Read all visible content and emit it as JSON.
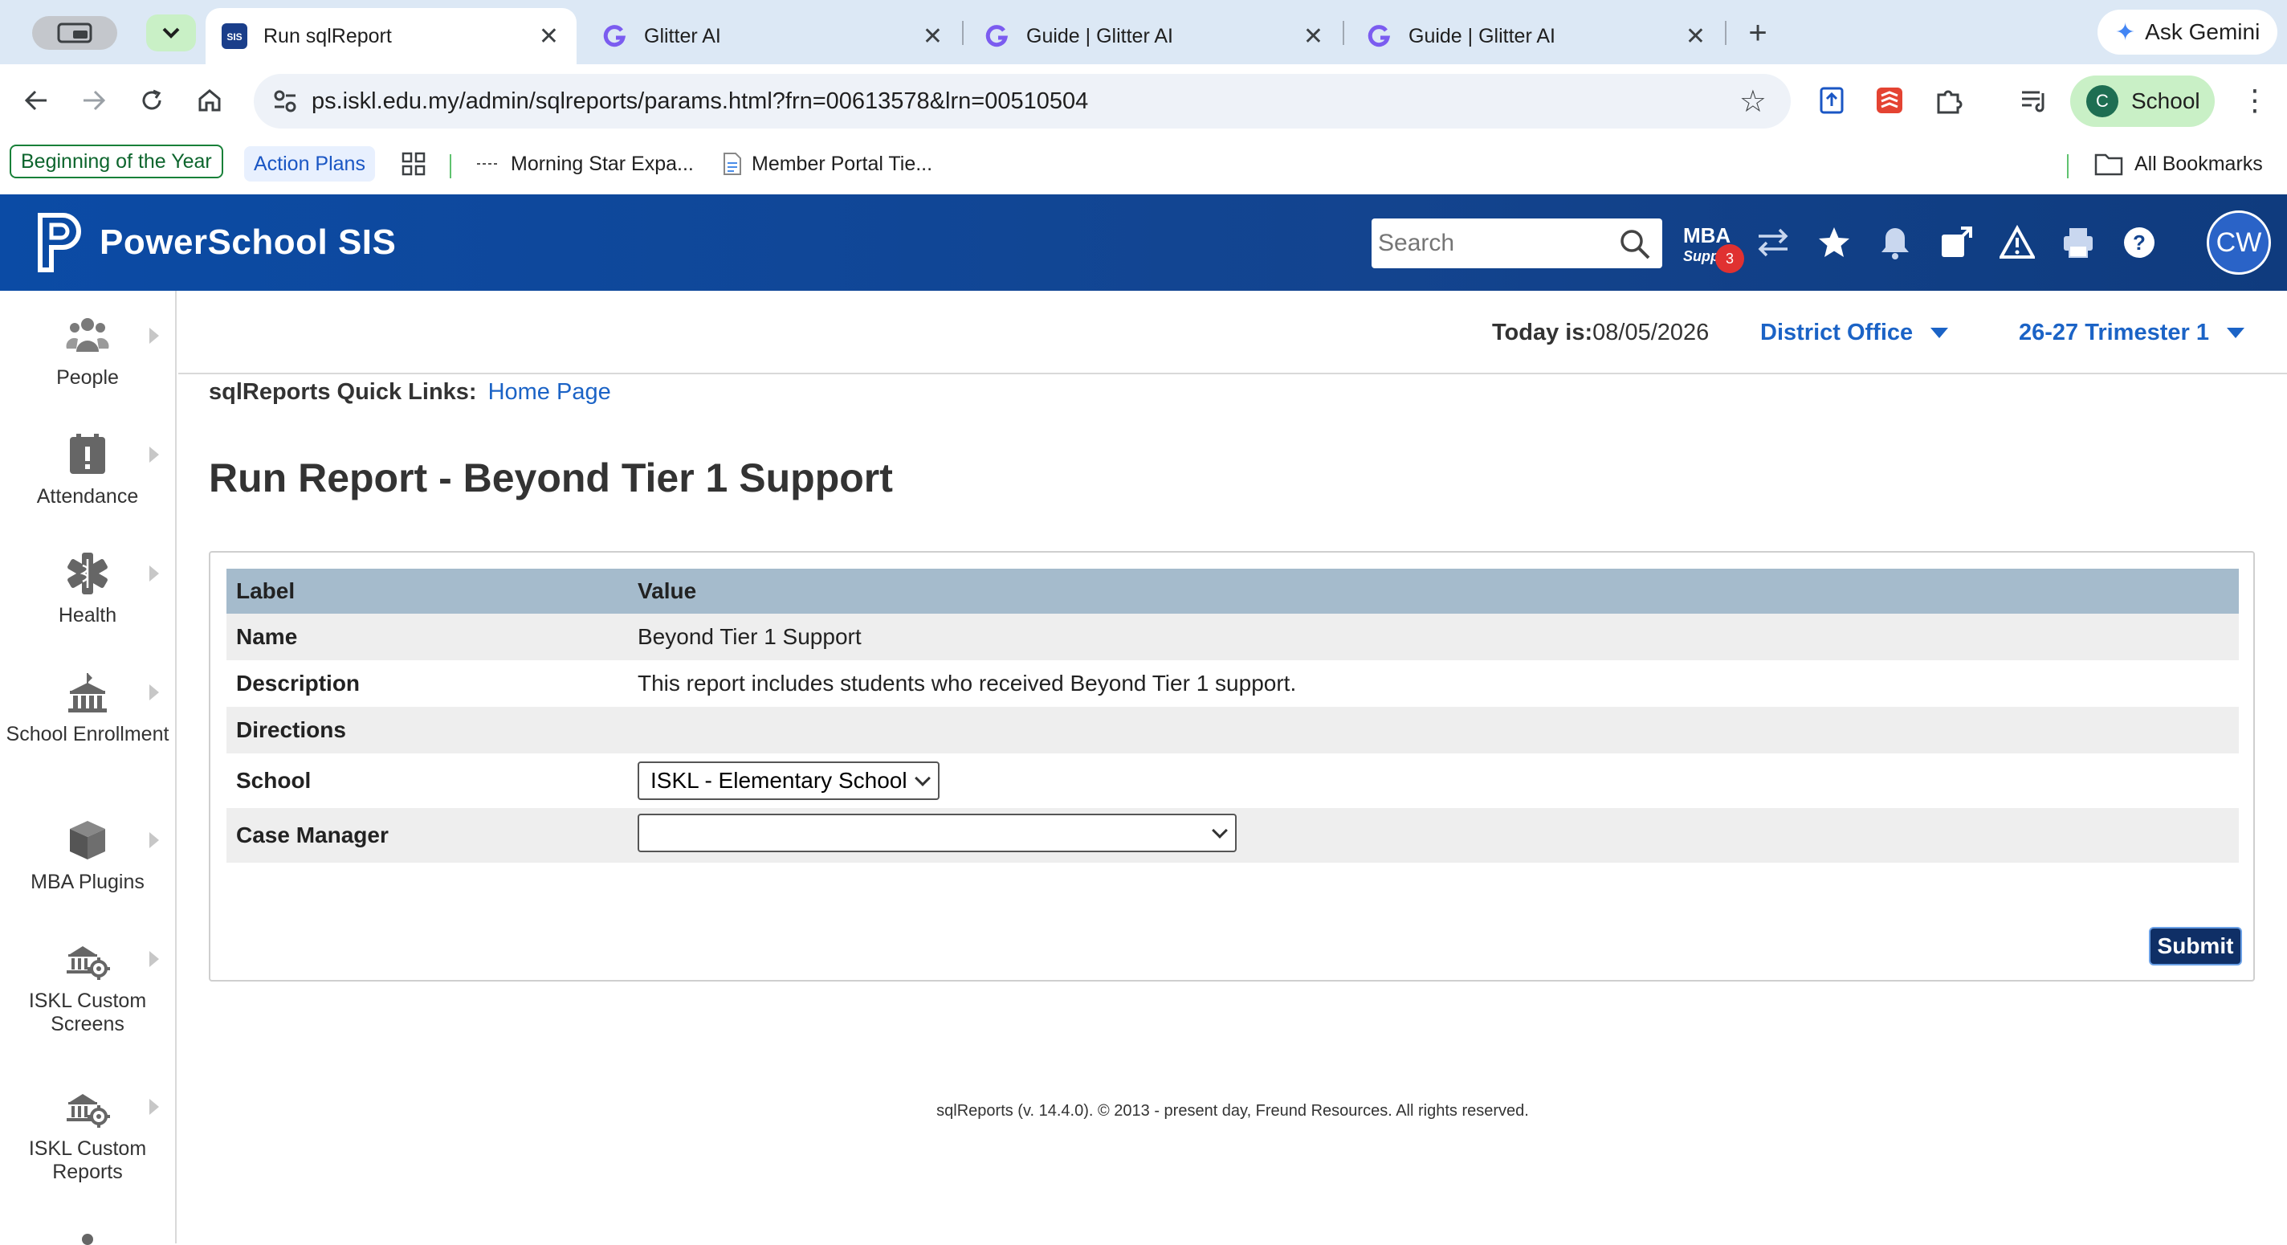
{
  "browser": {
    "tabs": [
      {
        "title": "Run sqlReport",
        "active": true,
        "favicon": "sis-icon"
      },
      {
        "title": "Glitter AI",
        "active": false,
        "favicon": "glitter-icon"
      },
      {
        "title": "Guide | Glitter AI",
        "active": false,
        "favicon": "glitter-icon"
      },
      {
        "title": "Guide | Glitter AI",
        "active": false,
        "favicon": "glitter-icon"
      }
    ],
    "favicon_sis_text": "SIS",
    "close_glyph": "✕",
    "new_tab_glyph": "+",
    "gemini_label": "Ask Gemini",
    "url": "ps.iskl.edu.my/admin/sqlreports/params.html?frn=00613578&lrn=00510504",
    "profile_initial": "C",
    "profile_label": "School",
    "bookmarks": [
      {
        "label": "Beginning of the Year",
        "style": "green-outline"
      },
      {
        "label": "Action Plans",
        "style": "blue-fill"
      },
      {
        "label": "Morning Star Expa...",
        "style": "plain"
      },
      {
        "label": "Member Portal Tie...",
        "style": "plain"
      }
    ],
    "all_bookmarks_label": "All Bookmarks"
  },
  "header": {
    "app_title": "PowerSchool SIS",
    "search_placeholder": "Search",
    "mba_line1": "MBA",
    "mba_line2": "Supp",
    "mba_badge": "3",
    "user_initials": "CW",
    "bg_color": "#0b4ba5"
  },
  "leftnav": {
    "items": [
      {
        "label": "People",
        "icon": "people-icon"
      },
      {
        "label": "Attendance",
        "icon": "attendance-icon"
      },
      {
        "label": "Health",
        "icon": "health-icon"
      },
      {
        "label": "School Enrollment",
        "icon": "school-icon"
      },
      {
        "label": "MBA Plugins",
        "icon": "plugin-box-icon"
      },
      {
        "label": "ISKL Custom Screens",
        "icon": "custom-screens-icon"
      },
      {
        "label": "ISKL Custom Reports",
        "icon": "custom-reports-icon"
      }
    ]
  },
  "context": {
    "today_label": "Today is:",
    "today_value": "08/05/2026",
    "school_selector": "District Office",
    "term_selector": "26-27 Trimester 1"
  },
  "main": {
    "quicklinks_label": "sqlReports Quick Links:",
    "quicklinks_home": "Home Page",
    "page_title": "Run Report - Beyond Tier 1 Support",
    "table_headers": {
      "label": "Label",
      "value": "Value"
    },
    "rows": {
      "name_label": "Name",
      "name_value": "Beyond Tier 1 Support",
      "description_label": "Description",
      "description_value": "This report includes students who received Beyond Tier 1 support.",
      "directions_label": "Directions",
      "school_label": "School",
      "school_value": "ISKL - Elementary School",
      "case_manager_label": "Case Manager",
      "case_manager_value": ""
    },
    "submit_label": "Submit"
  },
  "footer": {
    "text": "sqlReports (v. 14.4.0). © 2013 - present day, Freund Resources. All rights reserved."
  }
}
